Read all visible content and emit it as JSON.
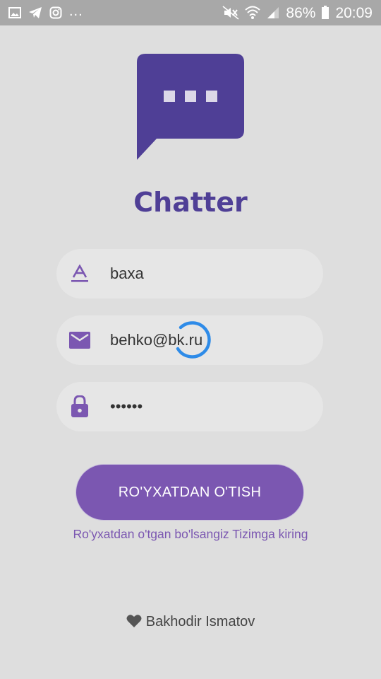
{
  "status_bar": {
    "battery_percent": "86%",
    "time": "20:09",
    "more_indicator": "...",
    "left_icons": [
      "image-icon",
      "telegram-icon",
      "instagram-icon"
    ],
    "right_icons": [
      "mute-icon",
      "wifi-icon",
      "signal-icon",
      "battery-icon"
    ]
  },
  "app": {
    "title": "Chatter",
    "brand_color": "#4f3f96",
    "accent_color": "#7b57b1"
  },
  "form": {
    "name_value": "baxa",
    "email_value": "behko@bk.ru",
    "password_value": "••••••",
    "name_icon": "text-format-icon",
    "email_icon": "mail-icon",
    "password_icon": "lock-icon"
  },
  "actions": {
    "register_label": "RO'YXATDAN O'TISH",
    "login_link": "Ro'yxatdan o'tgan bo'lsangiz Tizimga kiring"
  },
  "loading": {
    "visible": true,
    "spinner_color": "#2e8be8"
  },
  "footer": {
    "author": "Bakhodir Ismatov",
    "icon": "heart-icon"
  }
}
